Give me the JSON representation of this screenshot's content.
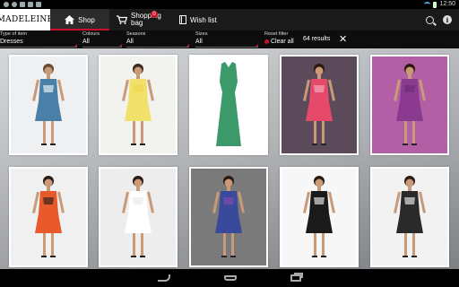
{
  "app": {
    "logo": "MADELEINE"
  },
  "status_bar": {
    "time": "12:50"
  },
  "nav": {
    "shop": "Shop",
    "bag_line1": "Shopping",
    "bag_line2": "bag",
    "bag_count": "0",
    "wish": "Wish list"
  },
  "filters": {
    "type": {
      "label": "Type of item",
      "value": "Dresses"
    },
    "colours": {
      "label": "Colours",
      "value": "All"
    },
    "seasons": {
      "label": "Seasons",
      "value": "All"
    },
    "sizes": {
      "label": "Sizes",
      "value": "All"
    },
    "reset": {
      "label": "Reset filter",
      "button": "Clear all"
    },
    "results": "64 results",
    "close": "✕"
  },
  "products": [
    {
      "bg": "#eef0f2",
      "dress": "#4a7fa8",
      "accent": "#ffffff",
      "skin": "#c99a78",
      "hair": "#6b4a2f"
    },
    {
      "bg": "#f2f2ee",
      "dress": "#f1e06a",
      "accent": "#f4d24d",
      "skin": "#c99a78",
      "hair": "#3b2a1c"
    },
    {
      "bg": "#ffffff",
      "dress": "#3c9a6a",
      "accent": "#3c9a6a",
      "skin": "#ffffff",
      "hair": "#ffffff"
    },
    {
      "bg": "#5a4a5a",
      "dress": "#e54a6a",
      "accent": "#f3b8c8",
      "skin": "#c99a78",
      "hair": "#2a1a10"
    },
    {
      "bg": "#b25fa6",
      "dress": "#8a3a8f",
      "accent": "#6a2a6f",
      "skin": "#c99a78",
      "hair": "#2a1a10"
    },
    {
      "bg": "#f0f0f0",
      "dress": "#e85a2a",
      "accent": "#1a1a1a",
      "skin": "#c99a78",
      "hair": "#2a1a10"
    },
    {
      "bg": "#ededed",
      "dress": "#ffffff",
      "accent": "#e8e8e8",
      "skin": "#c99a78",
      "hair": "#2a1a10"
    },
    {
      "bg": "#7a7a7a",
      "dress": "#3a4a9a",
      "accent": "#8a4ab0",
      "skin": "#c99a78",
      "hair": "#2a1a10"
    },
    {
      "bg": "#f7f7f7",
      "dress": "#1a1a1a",
      "accent": "#ffffff",
      "skin": "#c99a78",
      "hair": "#2a1a10"
    },
    {
      "bg": "#f2f2f2",
      "dress": "#2a2a2a",
      "accent": "#ffffff",
      "skin": "#c99a78",
      "hair": "#2a1a10"
    }
  ]
}
